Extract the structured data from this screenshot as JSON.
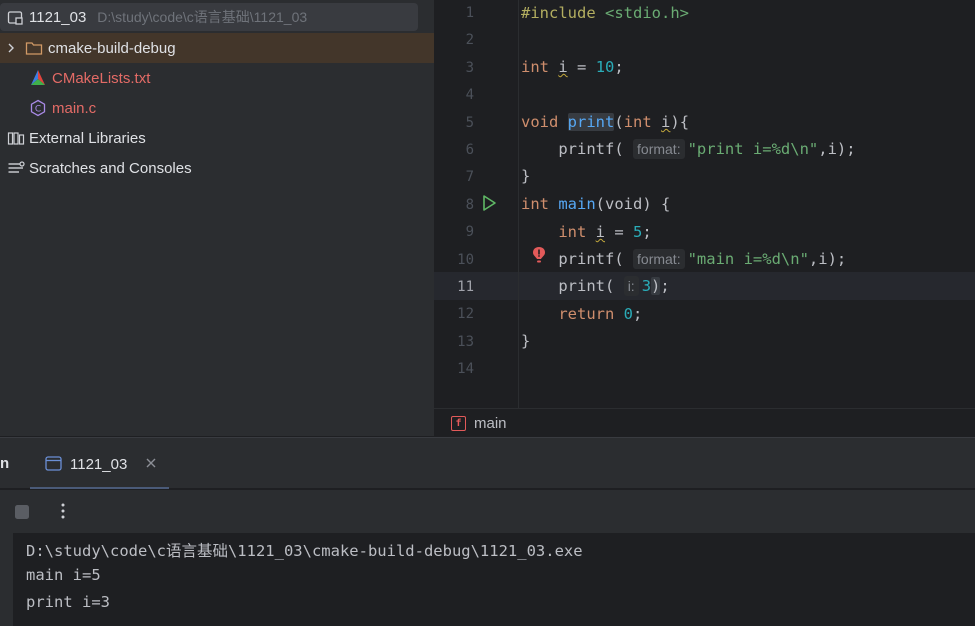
{
  "project_tree": {
    "root": {
      "name": "1121_03",
      "path": "D:\\study\\code\\c语言基础\\1121_03"
    },
    "items": [
      {
        "name": "cmake-build-debug",
        "type": "folder"
      },
      {
        "name": "CMakeLists.txt",
        "type": "cmake-file"
      },
      {
        "name": "main.c",
        "type": "c-file"
      },
      {
        "name": "External Libraries",
        "type": "libraries"
      },
      {
        "name": "Scratches and Consoles",
        "type": "scratches"
      }
    ]
  },
  "editor": {
    "line_numbers": [
      "1",
      "2",
      "3",
      "4",
      "5",
      "6",
      "7",
      "8",
      "9",
      "10",
      "11",
      "12",
      "13",
      "14"
    ],
    "current_line": 11,
    "hints": {
      "format": "format:",
      "param_i": "i:"
    },
    "tokens": {
      "include": "#include",
      "stdio": "<stdio.h>",
      "int": "int",
      "void": "void",
      "return": "return",
      "i": "i",
      "eq": " = ",
      "ten": "10",
      "five": "5",
      "three": "3",
      "zero": "0",
      "semi": ";",
      "print": "print",
      "printf": "printf",
      "main": "main",
      "print_fmt": "\"print i=%d\\n\"",
      "main_fmt": "\"main i=%d\\n\"",
      "tail_i": ",i);",
      "open_paren": "(",
      "close_paren": ")",
      "brace_open": "{",
      "brace_close": "}",
      "void_param": "(void) {",
      "int_param": "(int ",
      "close_brace_paren": "){"
    }
  },
  "breadcrumb": {
    "label": "main"
  },
  "run_panel": {
    "tab_partial": "n",
    "tab_label": "1121_03",
    "console_lines": [
      "D:\\study\\code\\c语言基础\\1121_03\\cmake-build-debug\\1121_03.exe",
      "main i=5",
      "print i=3"
    ]
  },
  "colors": {
    "keyword": "#cf8e6d",
    "string": "#6aab73",
    "number": "#2aacb8",
    "function": "#56a8f5",
    "preprocessor": "#b3ae60",
    "error": "#e25a5a"
  }
}
